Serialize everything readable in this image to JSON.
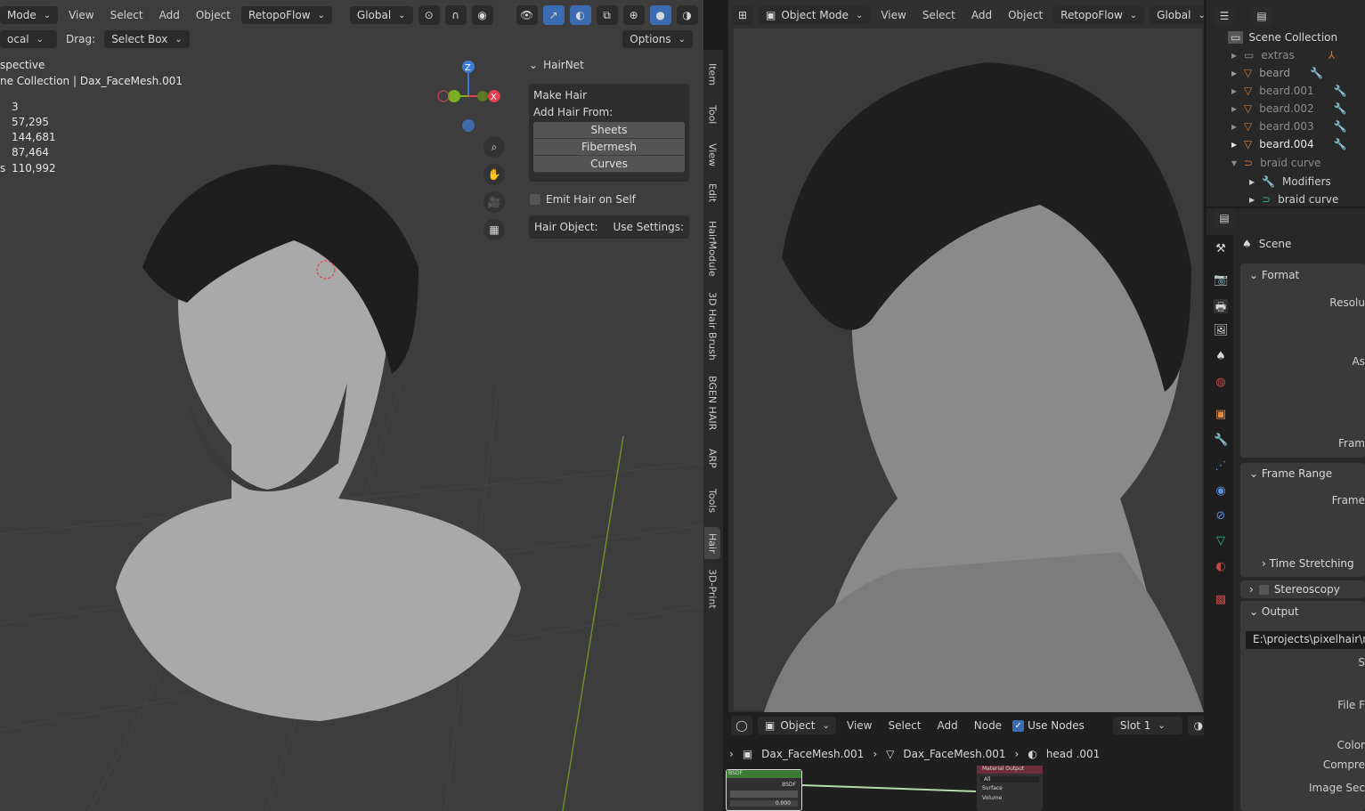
{
  "left_viewport": {
    "header": {
      "mode": "Mode",
      "menus": [
        "View",
        "Select",
        "Add",
        "Object"
      ],
      "retopoflow": "RetopoFlow",
      "orientation": "Global"
    },
    "tool_header": {
      "pivot": "ocal",
      "drag_label": "Drag:",
      "drag_value": "Select Box",
      "options": "Options"
    },
    "overlay": {
      "view_name": "spective",
      "collection": "ne Collection | Dax_FaceMesh.001",
      "stats": [
        "3",
        "57,295",
        "144,681",
        "87,464",
        "110,992"
      ],
      "stats_last_prefix": "s"
    },
    "gizmo": {
      "x": "X",
      "y": "Y",
      "z": "Z"
    },
    "hairnet": {
      "title": "HairNet",
      "make_hair": "Make Hair",
      "add_hair_from": "Add Hair From:",
      "buttons": [
        "Sheets",
        "Fibermesh",
        "Curves"
      ],
      "emit_hair": "Emit Hair on Self",
      "hair_object": "Hair Object:",
      "use_settings": "Use Settings:"
    },
    "tabs": [
      "Item",
      "Tool",
      "View",
      "Edit",
      "HairModule",
      "3D Hair Brush",
      "BGEN HAIR",
      "ARP",
      "Tools",
      "Hair",
      "3D-Print"
    ],
    "active_tab": "Hair"
  },
  "right_viewport": {
    "header": {
      "mode": "Object Mode",
      "menus": [
        "View",
        "Select",
        "Add",
        "Object"
      ],
      "retopoflow": "RetopoFlow",
      "orientation": "Global"
    }
  },
  "node_editor": {
    "header": {
      "type": "Object",
      "menus": [
        "View",
        "Select",
        "Add",
        "Node"
      ],
      "use_nodes": "Use Nodes",
      "use_nodes_checked": true,
      "slot": "Slot 1"
    },
    "breadcrumb": [
      "Dax_FaceMesh.001",
      "Dax_FaceMesh.001",
      "head .001"
    ],
    "bsdf_node": {
      "title": "BSDF",
      "output": "BSDF",
      "value": "0.000"
    },
    "output_node": {
      "title": "Material Output",
      "target": "All",
      "inputs": [
        "Surface",
        "Volume"
      ]
    }
  },
  "outliner": {
    "root": "Scene Collection",
    "items": [
      {
        "name": "extras",
        "type": "collection"
      },
      {
        "name": "beard",
        "type": "mesh"
      },
      {
        "name": "beard.001",
        "type": "mesh"
      },
      {
        "name": "beard.002",
        "type": "mesh"
      },
      {
        "name": "beard.003",
        "type": "mesh"
      },
      {
        "name": "beard.004",
        "type": "mesh"
      },
      {
        "name": "braid curve",
        "type": "curve"
      },
      {
        "name": "Modifiers",
        "type": "modifiers"
      },
      {
        "name": "braid curve",
        "type": "curve-data"
      }
    ]
  },
  "properties": {
    "context": "Scene",
    "sections": {
      "format": "Format",
      "frame_range": "Frame Range",
      "time_stretching": "Time Stretching",
      "stereoscopy": "Stereoscopy",
      "output": "Output"
    },
    "labels": {
      "resolution": "Resolu",
      "aspect": "As",
      "frame_rate": "Fram",
      "frame_start": "Frame",
      "file_format": "File F",
      "color": "Color",
      "compression": "Compre",
      "image_sequence": "Image Sec",
      "s": "S"
    },
    "output_path": "E:\\projects\\pixelhair\\me"
  },
  "colors": {
    "accent": "#3b6bb0",
    "mesh": "#c8783a",
    "modifier": "#5b8ee0",
    "data": "#2fb89a",
    "node_green": "#3a7a36",
    "node_red": "#6e2d3a"
  }
}
